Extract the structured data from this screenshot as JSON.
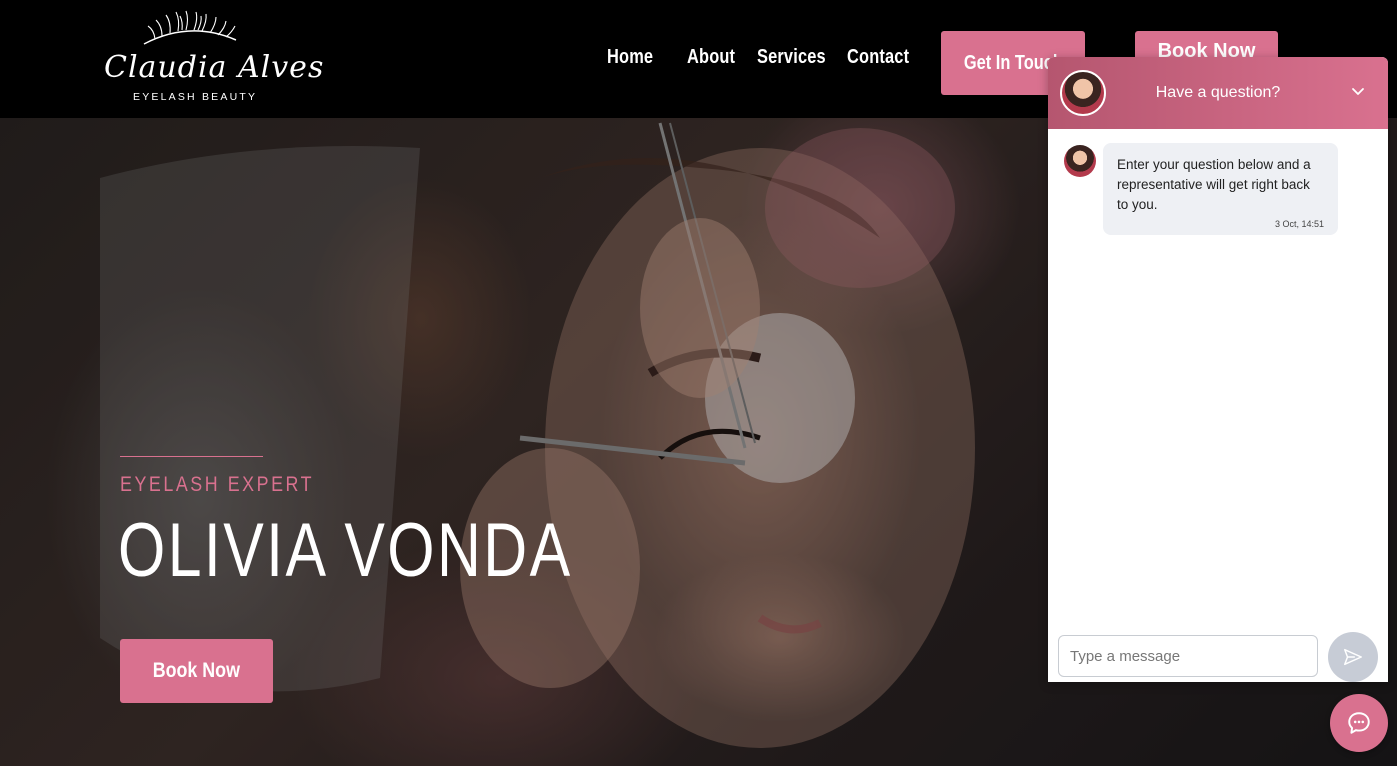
{
  "brand": {
    "name": "Claudia Alves",
    "tagline": "EYELASH BEAUTY"
  },
  "nav": {
    "items": [
      {
        "label": "Home"
      },
      {
        "label": "About"
      },
      {
        "label": "Services"
      },
      {
        "label": "Contact"
      }
    ]
  },
  "header": {
    "get_in_touch_label": "Get In Touch",
    "book_label": "Book Now"
  },
  "hero": {
    "kicker": "EYELASH EXPERT",
    "name": "OLIVIA VONDA",
    "cta_label": "Book Now"
  },
  "chat": {
    "title": "Have a question?",
    "message": {
      "text": "Enter your question below and a representative will get right back to you.",
      "time": "3 Oct, 14:51"
    },
    "input_placeholder": "Type a message"
  },
  "colors": {
    "accent": "#d9718f",
    "header_bg": "#000000"
  },
  "icons": {
    "collapse": "chevron-down-icon",
    "send": "send-icon",
    "launcher": "chat-bubble-icon"
  }
}
